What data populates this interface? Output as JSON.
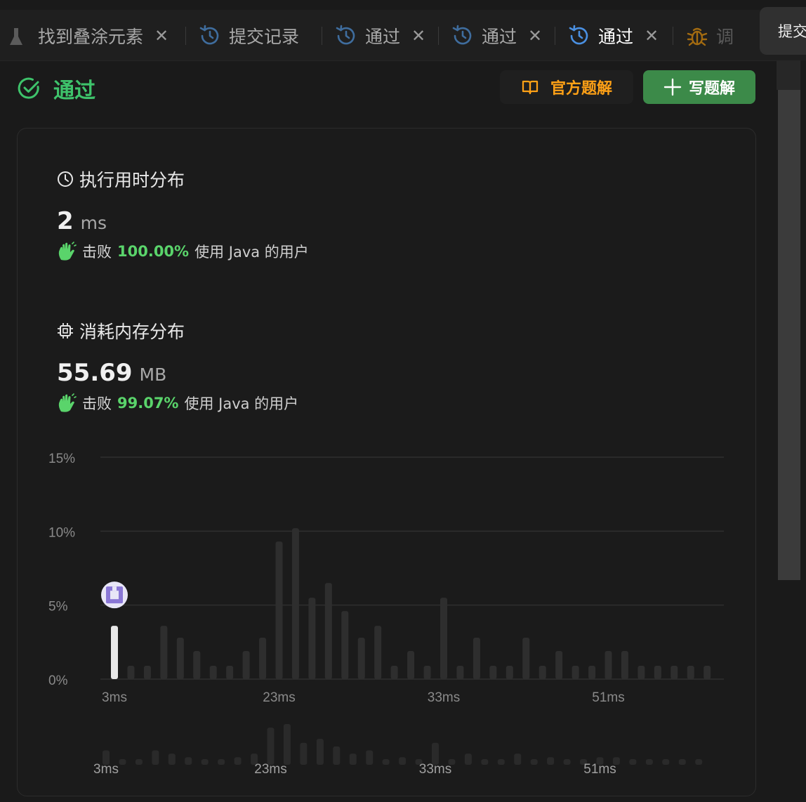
{
  "tabs": [
    {
      "label": "找到叠涂元素",
      "icon": "flask-icon",
      "closable": true,
      "active": false
    },
    {
      "label": "提交记录",
      "icon": "history-icon",
      "closable": false,
      "active": false
    },
    {
      "label": "通过",
      "icon": "history-icon",
      "closable": true,
      "active": false
    },
    {
      "label": "通过",
      "icon": "history-icon",
      "closable": true,
      "active": false
    },
    {
      "label": "通过",
      "icon": "history-icon",
      "closable": true,
      "active": true
    },
    {
      "label": "调",
      "icon": "bug-icon",
      "closable": false,
      "active": false
    }
  ],
  "tooltip": "提交",
  "status": {
    "label": "通过",
    "icon": "check-circle-icon",
    "color": "#3ec36b"
  },
  "buttons": {
    "official_solution": "官方题解",
    "write_solution": "写题解"
  },
  "runtime": {
    "title": "执行用时分布",
    "value": "2",
    "unit": "ms",
    "beats_prefix": "击败",
    "beats_percent": "100.00%",
    "beats_suffix": "使用 Java 的用户"
  },
  "memory": {
    "title": "消耗内存分布",
    "value": "55.69",
    "unit": "MB",
    "beats_prefix": "击败",
    "beats_percent": "99.07%",
    "beats_suffix": "使用 Java 的用户"
  },
  "colors": {
    "accent_green": "#5ad46b",
    "accent_orange": "#ffa116",
    "button_green": "#3c8a49"
  },
  "chart_data": {
    "type": "bar",
    "ylim": [
      0,
      15
    ],
    "y_ticks": [
      "15%",
      "10%",
      "5%",
      "0%"
    ],
    "y_tick_values": [
      15,
      10,
      5,
      0
    ],
    "x_tick_labels": [
      {
        "label": "3ms",
        "index": 0
      },
      {
        "label": "23ms",
        "index": 10
      },
      {
        "label": "33ms",
        "index": 20
      },
      {
        "label": "51ms",
        "index": 30
      }
    ],
    "values": [
      3.6,
      0.9,
      0.9,
      3.6,
      2.8,
      1.9,
      0.9,
      0.9,
      1.9,
      2.8,
      9.3,
      10.2,
      5.5,
      6.5,
      4.6,
      2.8,
      3.6,
      0.9,
      1.9,
      0.9,
      5.5,
      0.9,
      2.8,
      0.9,
      0.9,
      2.8,
      0.9,
      1.9,
      0.9,
      0.9,
      1.9,
      1.9,
      0.9,
      0.9,
      0.9,
      0.9,
      0.9
    ],
    "highlight_index": 0,
    "grid": true
  },
  "overview_data": {
    "x_tick_labels": [
      {
        "label": "3ms",
        "index": 0
      },
      {
        "label": "23ms",
        "index": 10
      },
      {
        "label": "33ms",
        "index": 20
      },
      {
        "label": "51ms",
        "index": 30
      }
    ]
  }
}
